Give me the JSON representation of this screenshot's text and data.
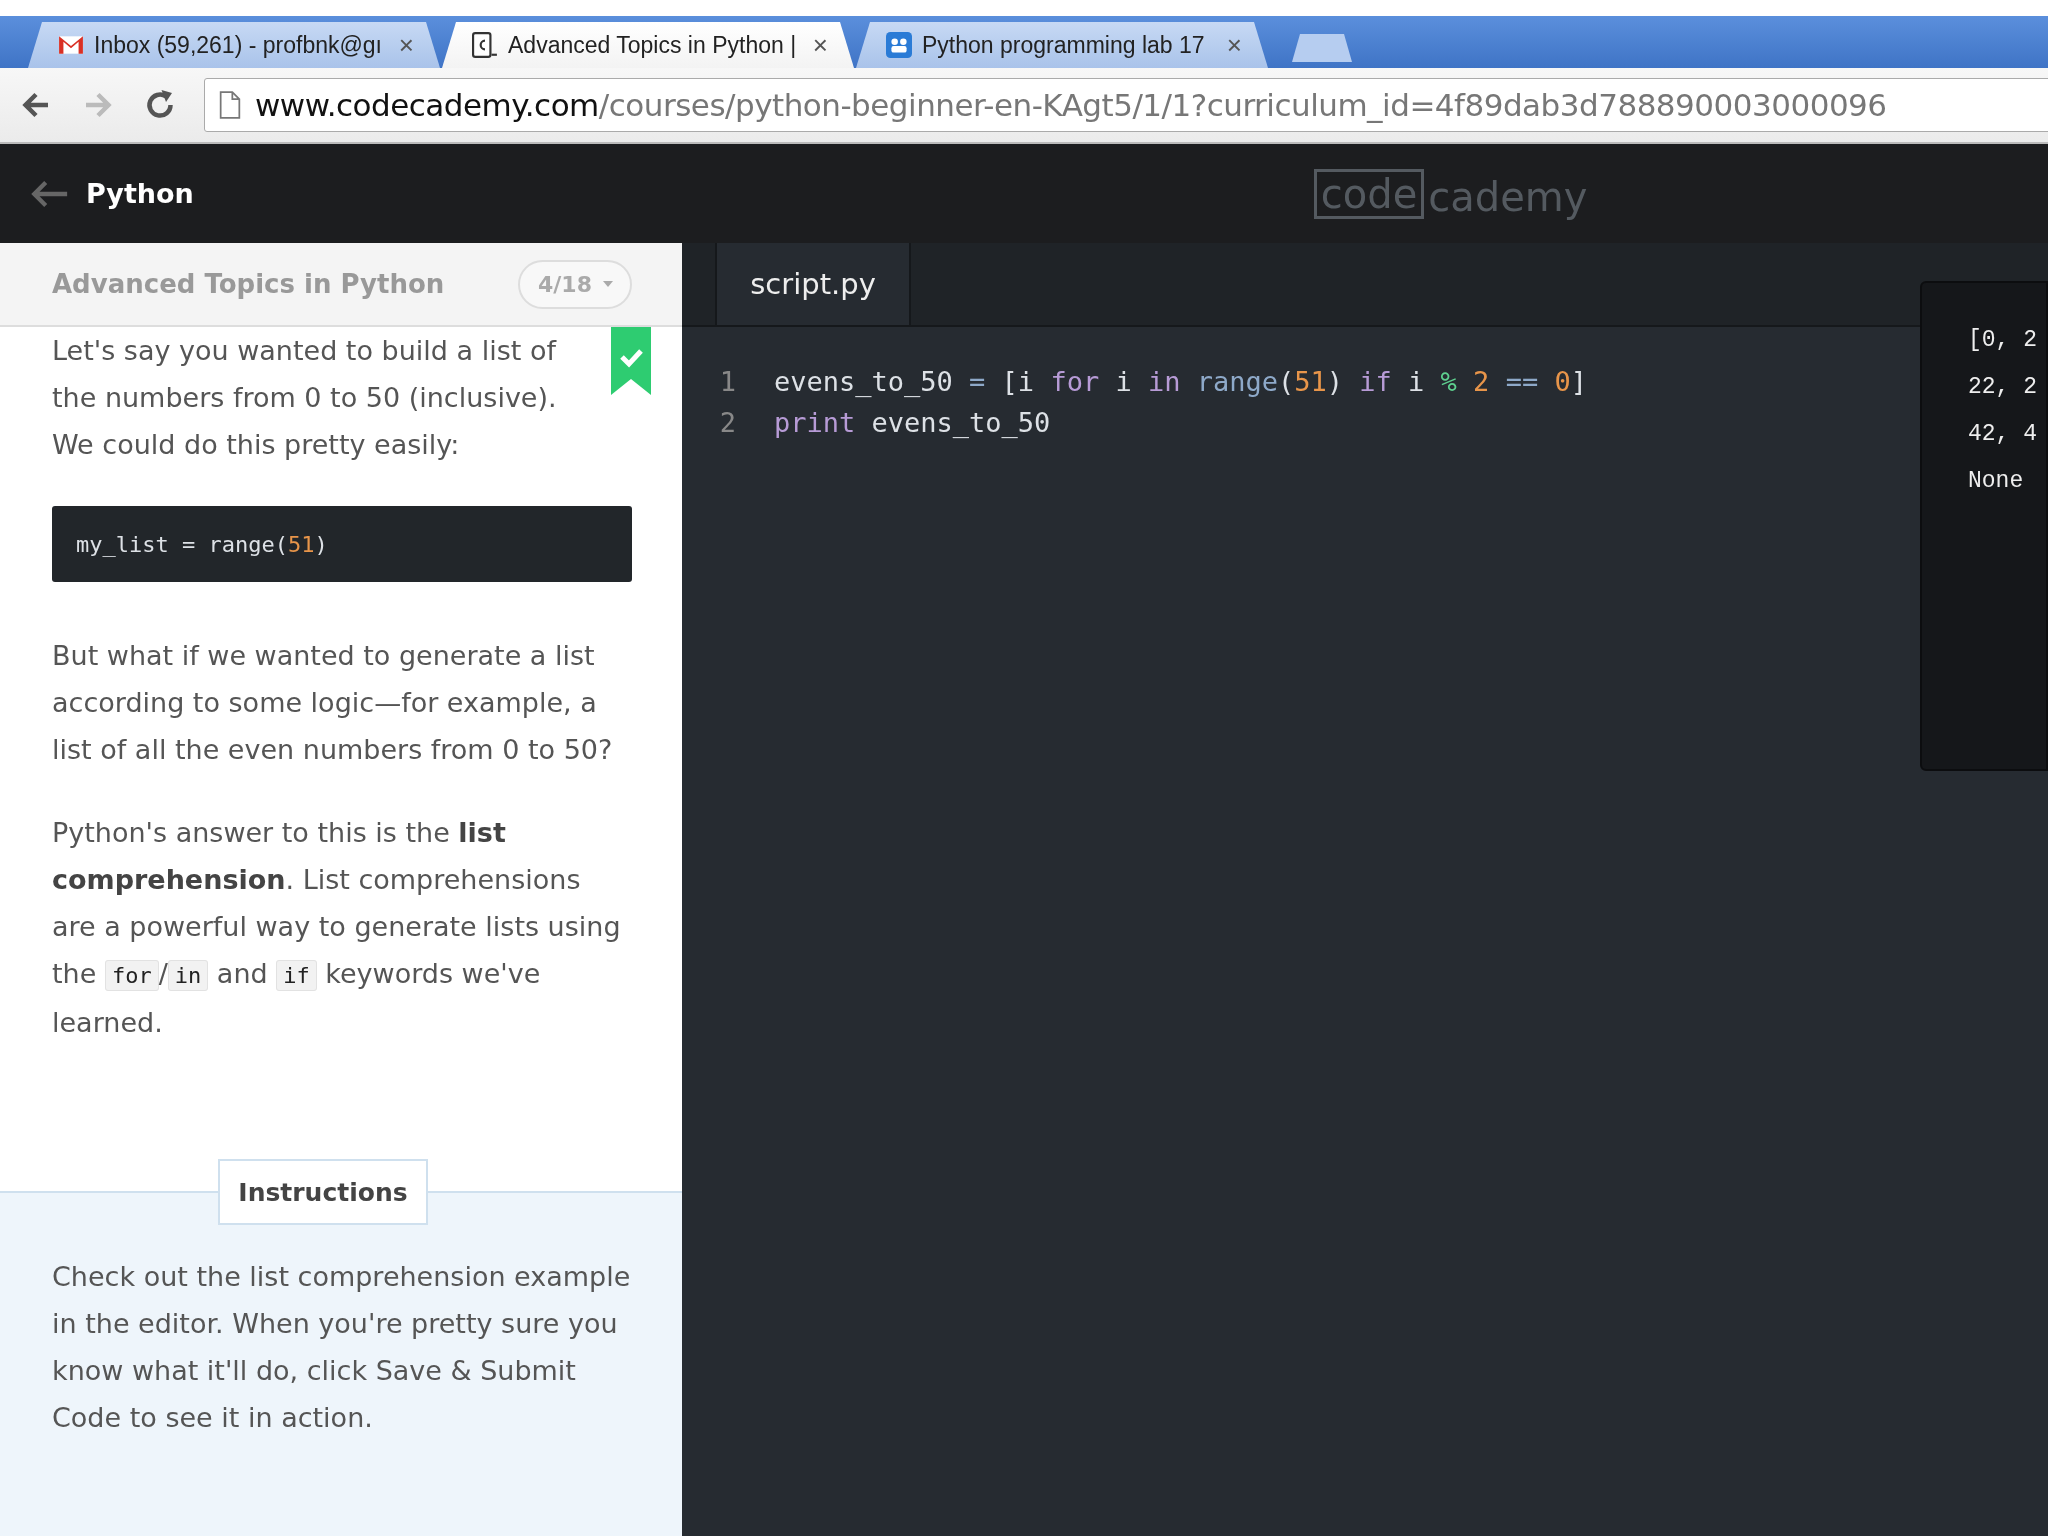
{
  "browser": {
    "tabs": [
      {
        "title": "Inbox (59,261) - profbnk@gı",
        "close": "×",
        "selected": false
      },
      {
        "title": "Advanced Topics in Python |",
        "close": "×",
        "selected": true
      },
      {
        "title": "Python programming lab 17",
        "close": "×",
        "selected": false
      }
    ],
    "back_disabled": false,
    "forward_disabled": true,
    "url_host": "www.codecademy.com",
    "url_path": "/courses/python-beginner-en-KAgt5/1/1?curriculum_id=4f89dab3d788890003000096"
  },
  "header": {
    "title": "Python",
    "logo": [
      "code",
      "cademy"
    ]
  },
  "lesson": {
    "title": "Advanced Topics in Python",
    "progress": "4/18",
    "completed": true,
    "content": [
      {
        "kind": "paragraph",
        "segments": [
          {
            "kind": "text",
            "text": "Let's say you wanted to build a list of the numbers from 0 to 50 (inclusive). We could do this pretty easily:"
          }
        ]
      },
      {
        "kind": "code",
        "tokens": [
          {
            "kind": "plain",
            "text": "my_list = range("
          },
          {
            "kind": "number",
            "text": "51"
          },
          {
            "kind": "plain",
            "text": ")"
          }
        ]
      },
      {
        "kind": "paragraph",
        "segments": [
          {
            "kind": "text",
            "text": "But what if we wanted to generate a list according to some logic—for example, a list of all the even numbers from 0 to 50?"
          }
        ]
      },
      {
        "kind": "paragraph",
        "segments": [
          {
            "kind": "text",
            "text": "Python's answer to this is the **list comprehension**. List comprehensions are a powerful way to generate lists using the "
          },
          {
            "kind": "code",
            "text": "for"
          },
          {
            "kind": "text",
            "text": "/"
          },
          {
            "kind": "code",
            "text": "in"
          },
          {
            "kind": "text",
            "text": " and "
          },
          {
            "kind": "code",
            "text": "if"
          },
          {
            "kind": "text",
            "text": " keywords we've learned."
          }
        ]
      }
    ],
    "instructions_label": "Instructions",
    "instructions": "Check out the list comprehension example in the editor. When you're pretty sure you know what it'll do, click Save & Submit Code to see it in action."
  },
  "editor": {
    "file_tab": "script.py",
    "lines": [
      {
        "number": "1",
        "tokens": [
          {
            "kind": "plain",
            "text": "evens_to_50 "
          },
          {
            "kind": "operator",
            "text": "="
          },
          {
            "kind": "plain",
            "text": " [i "
          },
          {
            "kind": "keyword",
            "text": "for"
          },
          {
            "kind": "plain",
            "text": " i "
          },
          {
            "kind": "keyword",
            "text": "in"
          },
          {
            "kind": "builtin",
            "text": " range"
          },
          {
            "kind": "plain",
            "text": "("
          },
          {
            "kind": "number",
            "text": "51"
          },
          {
            "kind": "plain",
            "text": ") "
          },
          {
            "kind": "keyword",
            "text": "if"
          },
          {
            "kind": "plain",
            "text": " i "
          },
          {
            "kind": "modulo",
            "text": "%"
          },
          {
            "kind": "number",
            "text": " 2"
          },
          {
            "kind": "operator",
            "text": " =="
          },
          {
            "kind": "number",
            "text": " 0"
          },
          {
            "kind": "plain",
            "text": "]"
          }
        ]
      },
      {
        "number": "2",
        "tokens": [
          {
            "kind": "keyword",
            "text": "print"
          },
          {
            "kind": "plain",
            "text": " evens_to_50"
          }
        ]
      }
    ]
  },
  "output": {
    "lines": [
      "[0, 2",
      "22, 2",
      "42, 4",
      "None"
    ]
  }
}
